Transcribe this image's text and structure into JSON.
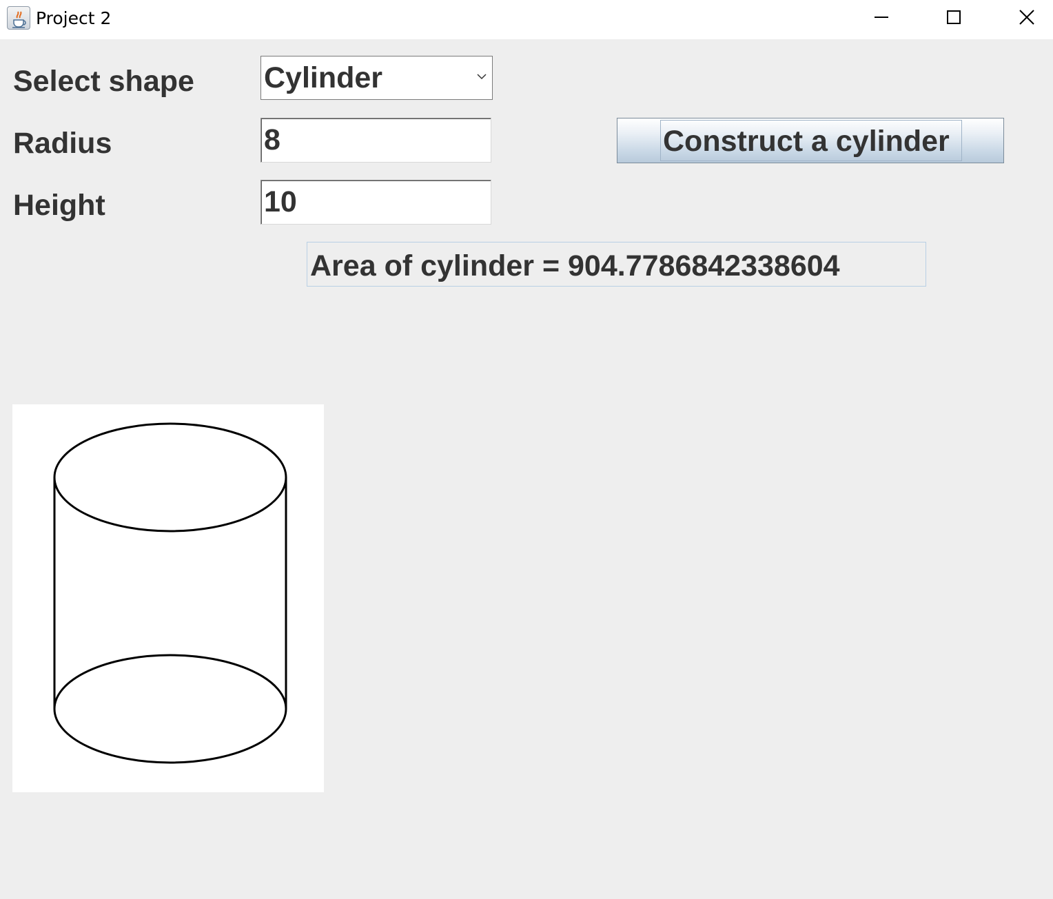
{
  "window": {
    "title": "Project 2",
    "app_icon": "java-cup-icon",
    "controls": [
      "minimize-icon",
      "maximize-icon",
      "close-icon"
    ]
  },
  "form": {
    "shape_label": "Select shape",
    "shape_selected": "Cylinder",
    "radius_label": "Radius",
    "radius_value": "8",
    "height_label": "Height",
    "height_value": "10",
    "construct_button": "Construct a cylinder",
    "result_text": "Area of cylinder = 904.7786842338604"
  },
  "drawing": {
    "shape": "cylinder",
    "stroke_color": "#000000",
    "background": "#ffffff"
  },
  "colors": {
    "window_bg": "#eeeeee",
    "text": "#333333",
    "button_gradient_end": "#b8cadb",
    "result_border": "#b8cfe4"
  }
}
